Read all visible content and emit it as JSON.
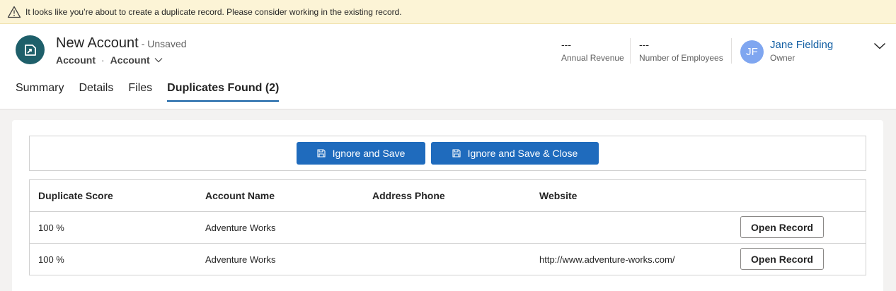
{
  "banner": {
    "icon": "warning-triangle-icon",
    "text": "It looks like you’re about to create a duplicate record. Please consider working in the existing record."
  },
  "record": {
    "icon": "account-icon",
    "title": "New Account",
    "unsaved": "- Unsaved",
    "entity": "Account",
    "separator": "·",
    "form": "Account"
  },
  "header_fields": [
    {
      "value": "---",
      "label": "Annual Revenue"
    },
    {
      "value": "---",
      "label": "Number of Employees"
    }
  ],
  "owner": {
    "initials": "JF",
    "name": "Jane Fielding",
    "label": "Owner",
    "avatar_color": "#7fa6f0"
  },
  "tabs": [
    {
      "label": "Summary",
      "active": false
    },
    {
      "label": "Details",
      "active": false
    },
    {
      "label": "Files",
      "active": false
    },
    {
      "label": "Duplicates Found (2)",
      "active": true
    }
  ],
  "actions": {
    "ignore_save": "Ignore and Save",
    "ignore_save_close": "Ignore and Save & Close",
    "accent": "#1f6bbd"
  },
  "duplicates": {
    "columns": [
      "Duplicate Score",
      "Account Name",
      "Address Phone",
      "Website"
    ],
    "rows": [
      {
        "score": "100 %",
        "name": "Adventure Works",
        "phone": "",
        "website": "",
        "action": "Open Record"
      },
      {
        "score": "100 %",
        "name": "Adventure Works",
        "phone": "",
        "website": "http://www.adventure-works.com/",
        "action": "Open Record"
      }
    ]
  }
}
